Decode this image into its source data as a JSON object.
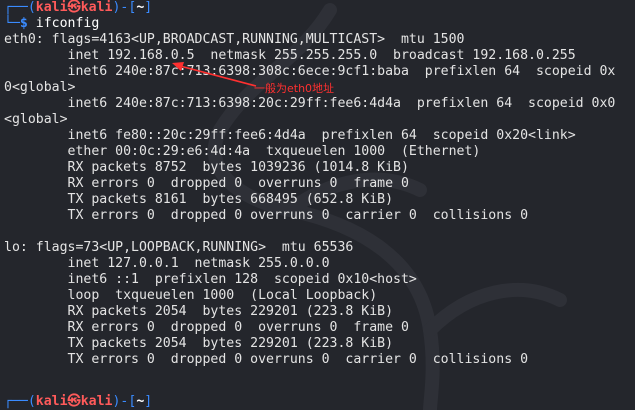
{
  "prompt1": {
    "top_left": "┌──(",
    "user": "kali",
    "at": "㉿",
    "host": "kali",
    "dir_open": ")-[",
    "dir": "~",
    "dir_close": "]",
    "bottom_left": "└─",
    "dollar": "$",
    "command": " ifconfig"
  },
  "output": {
    "lines": [
      "eth0: flags=4163<UP,BROADCAST,RUNNING,MULTICAST>  mtu 1500",
      "        inet 192.168.0.5  netmask 255.255.255.0  broadcast 192.168.0.255",
      "        inet6 240e:87c:713:6398:308c:6ece:9cf1:baba  prefixlen 64  scopeid 0x",
      "0<global>",
      "        inet6 240e:87c:713:6398:20c:29ff:fee6:4d4a  prefixlen 64  scopeid 0x0",
      "<global>",
      "        inet6 fe80::20c:29ff:fee6:4d4a  prefixlen 64  scopeid 0x20<link>",
      "        ether 00:0c:29:e6:4d:4a  txqueuelen 1000  (Ethernet)",
      "        RX packets 8752  bytes 1039236 (1014.8 KiB)",
      "        RX errors 0  dropped 0  overruns 0  frame 0",
      "        TX packets 8161  bytes 668495 (652.8 KiB)",
      "        TX errors 0  dropped 0 overruns 0  carrier 0  collisions 0",
      "",
      "lo: flags=73<UP,LOOPBACK,RUNNING>  mtu 65536",
      "        inet 127.0.0.1  netmask 255.0.0.0",
      "        inet6 ::1  prefixlen 128  scopeid 0x10<host>",
      "        loop  txqueuelen 1000  (Local Loopback)",
      "        RX packets 2054  bytes 229201 (223.8 KiB)",
      "        RX errors 0  dropped 0  overruns 0  frame 0",
      "        TX packets 2054  bytes 229201 (223.8 KiB)",
      "        TX errors 0  dropped 0 overruns 0  carrier 0  collisions 0"
    ]
  },
  "annotation": {
    "text": "一般为eth0地址",
    "color": "#ff3030"
  },
  "prompt2": {
    "top_left": "┌──(",
    "user": "kali",
    "at": "㉿",
    "host": "kali",
    "dir_open": ")-[",
    "dir": "~",
    "dir_close": "]"
  },
  "colors": {
    "background": "#24262c",
    "prompt_frame": "#3a8bff",
    "prompt_user": "#ff5a5a",
    "text": "#e4e4e4"
  }
}
